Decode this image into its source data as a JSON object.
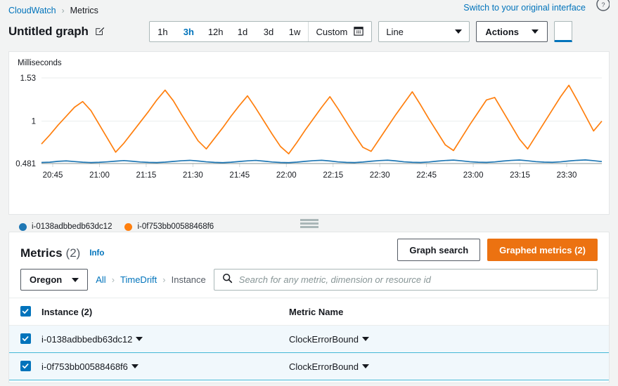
{
  "breadcrumb": {
    "root": "CloudWatch",
    "current": "Metrics"
  },
  "header": {
    "graph_title": "Untitled graph",
    "edit_icon": "edit-pencil-icon",
    "switch_link": "Switch to your original interface",
    "help_icon": "help-circle-icon",
    "time_ranges": [
      "1h",
      "3h",
      "12h",
      "1d",
      "3d",
      "1w"
    ],
    "active_range": "3h",
    "custom_label": "Custom",
    "calendar_icon": "calendar-icon",
    "chart_type": "Line",
    "actions_label": "Actions"
  },
  "chart_data": {
    "type": "line",
    "title": "",
    "ylabel": "Milliseconds",
    "xlabel": "",
    "ylim": [
      0.481,
      1.53
    ],
    "ytick_labels": [
      "1.53",
      "1",
      "0.481"
    ],
    "ytick_values": [
      1.53,
      1,
      0.481
    ],
    "xtick_labels": [
      "20:45",
      "21:00",
      "21:15",
      "21:30",
      "21:45",
      "22:00",
      "22:15",
      "22:30",
      "22:45",
      "23:00",
      "23:15",
      "23:30"
    ],
    "grid": true,
    "legend_position": "bottom-left",
    "series": [
      {
        "name": "i-0138adbbedb63dc12",
        "color": "#1f77b4",
        "values": [
          0.494,
          0.497,
          0.508,
          0.513,
          0.505,
          0.497,
          0.493,
          0.496,
          0.502,
          0.51,
          0.517,
          0.509,
          0.5,
          0.495,
          0.493,
          0.498,
          0.507,
          0.515,
          0.52,
          0.512,
          0.502,
          0.495,
          0.492,
          0.497,
          0.506,
          0.514,
          0.519,
          0.51,
          0.5,
          0.494,
          0.492,
          0.498,
          0.508,
          0.516,
          0.521,
          0.512,
          0.501,
          0.495,
          0.493,
          0.499,
          0.509,
          0.517,
          0.522,
          0.513,
          0.502,
          0.496,
          0.494,
          0.5,
          0.51,
          0.518,
          0.523,
          0.514,
          0.503,
          0.497,
          0.495,
          0.501,
          0.511,
          0.519,
          0.524,
          0.515,
          0.504,
          0.498,
          0.496,
          0.502,
          0.512,
          0.52,
          0.525,
          0.516,
          0.505
        ]
      },
      {
        "name": "i-0f753bb00588468f6",
        "color": "#ff7f0e",
        "values": [
          0.72,
          0.83,
          0.95,
          1.06,
          1.17,
          1.24,
          1.13,
          0.96,
          0.79,
          0.62,
          0.73,
          0.86,
          0.99,
          1.12,
          1.26,
          1.38,
          1.25,
          1.08,
          0.92,
          0.76,
          0.66,
          0.79,
          0.92,
          1.06,
          1.19,
          1.31,
          1.16,
          1.0,
          0.84,
          0.69,
          0.6,
          0.74,
          0.89,
          1.03,
          1.17,
          1.3,
          1.15,
          0.99,
          0.83,
          0.68,
          0.63,
          0.78,
          0.93,
          1.08,
          1.22,
          1.36,
          1.2,
          1.03,
          0.87,
          0.71,
          0.64,
          0.8,
          0.96,
          1.11,
          1.26,
          1.29,
          1.12,
          0.95,
          0.78,
          0.66,
          0.82,
          0.98,
          1.14,
          1.3,
          1.44,
          1.26,
          1.07,
          0.88,
          1.0
        ]
      }
    ]
  },
  "resize_handle": "panel-resize-handle",
  "metrics": {
    "title": "Metrics",
    "count": "(2)",
    "info_label": "Info",
    "graph_search_label": "Graph search",
    "graphed_metrics_label": "Graphed metrics (2)",
    "region": "Oregon",
    "filter_breadcrumb": {
      "all": "All",
      "namespace": "TimeDrift",
      "dimension": "Instance"
    },
    "search_placeholder": "Search for any metric, dimension or resource id",
    "search_icon": "search-icon",
    "columns": {
      "instance": "Instance  (2)",
      "metric_name": "Metric Name"
    },
    "rows": [
      {
        "instance": "i-0138adbbedb63dc12",
        "metric_name": "ClockErrorBound",
        "checked": true
      },
      {
        "instance": "i-0f753bb00588468f6",
        "metric_name": "ClockErrorBound",
        "checked": true
      }
    ]
  },
  "colors": {
    "link": "#0073bb",
    "orange": "#ec7211",
    "series_blue": "#1f77b4",
    "series_orange": "#ff7f0e"
  }
}
